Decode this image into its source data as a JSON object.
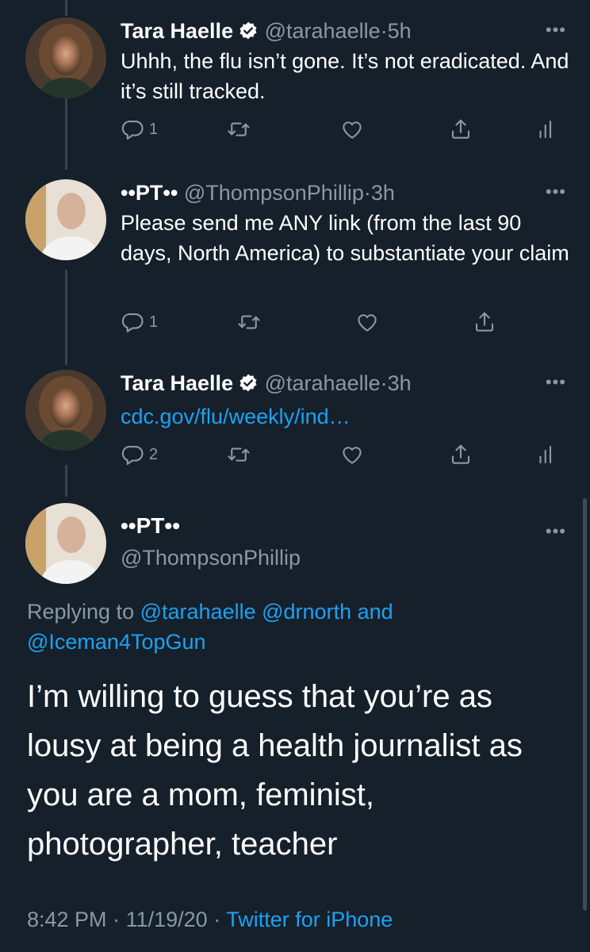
{
  "tweets": [
    {
      "name": "Tara Haelle",
      "handle": "@tarahaelle",
      "sep": "·",
      "time": "5h",
      "text": "Uhhh, the flu isn’t gone. It’s not eradicated. And it’s still tracked.",
      "reply_count": "1"
    },
    {
      "name": "••PT••",
      "handle": "@ThompsonPhillip",
      "sep": "·",
      "time": "3h",
      "text": "Please send me ANY link (from the last 90 days, North America) to substantiate your claim",
      "reply_count": "1"
    },
    {
      "name": "Tara Haelle",
      "handle": "@tarahaelle",
      "sep": "·",
      "time": "3h",
      "text": "cdc.gov/flu/weekly/ind…",
      "reply_count": "2"
    }
  ],
  "focused": {
    "name": "••PT••",
    "handle": "@ThompsonPhillip",
    "replying_prefix": "Replying to",
    "mention1": "@tarahaelle",
    "mention2": "@drnorth",
    "and": "and",
    "mention3": "@Iceman4TopGun",
    "text": "I’m willing to guess that you’re as lousy at being a health journalist as you are a mom, feminist, photographer, teacher",
    "time": "8:42 PM",
    "date": "11/19/20",
    "source": "Twitter for iPhone",
    "sep": "·"
  },
  "more_glyph": "•••",
  "colors": {
    "background": "#15202b",
    "secondary_text": "#8899a6",
    "link": "#1da1f2",
    "verified": "#ffffff"
  },
  "icons": [
    "reply-icon",
    "retweet-icon",
    "like-icon",
    "share-icon",
    "analytics-icon",
    "verified-icon",
    "more-icon"
  ]
}
